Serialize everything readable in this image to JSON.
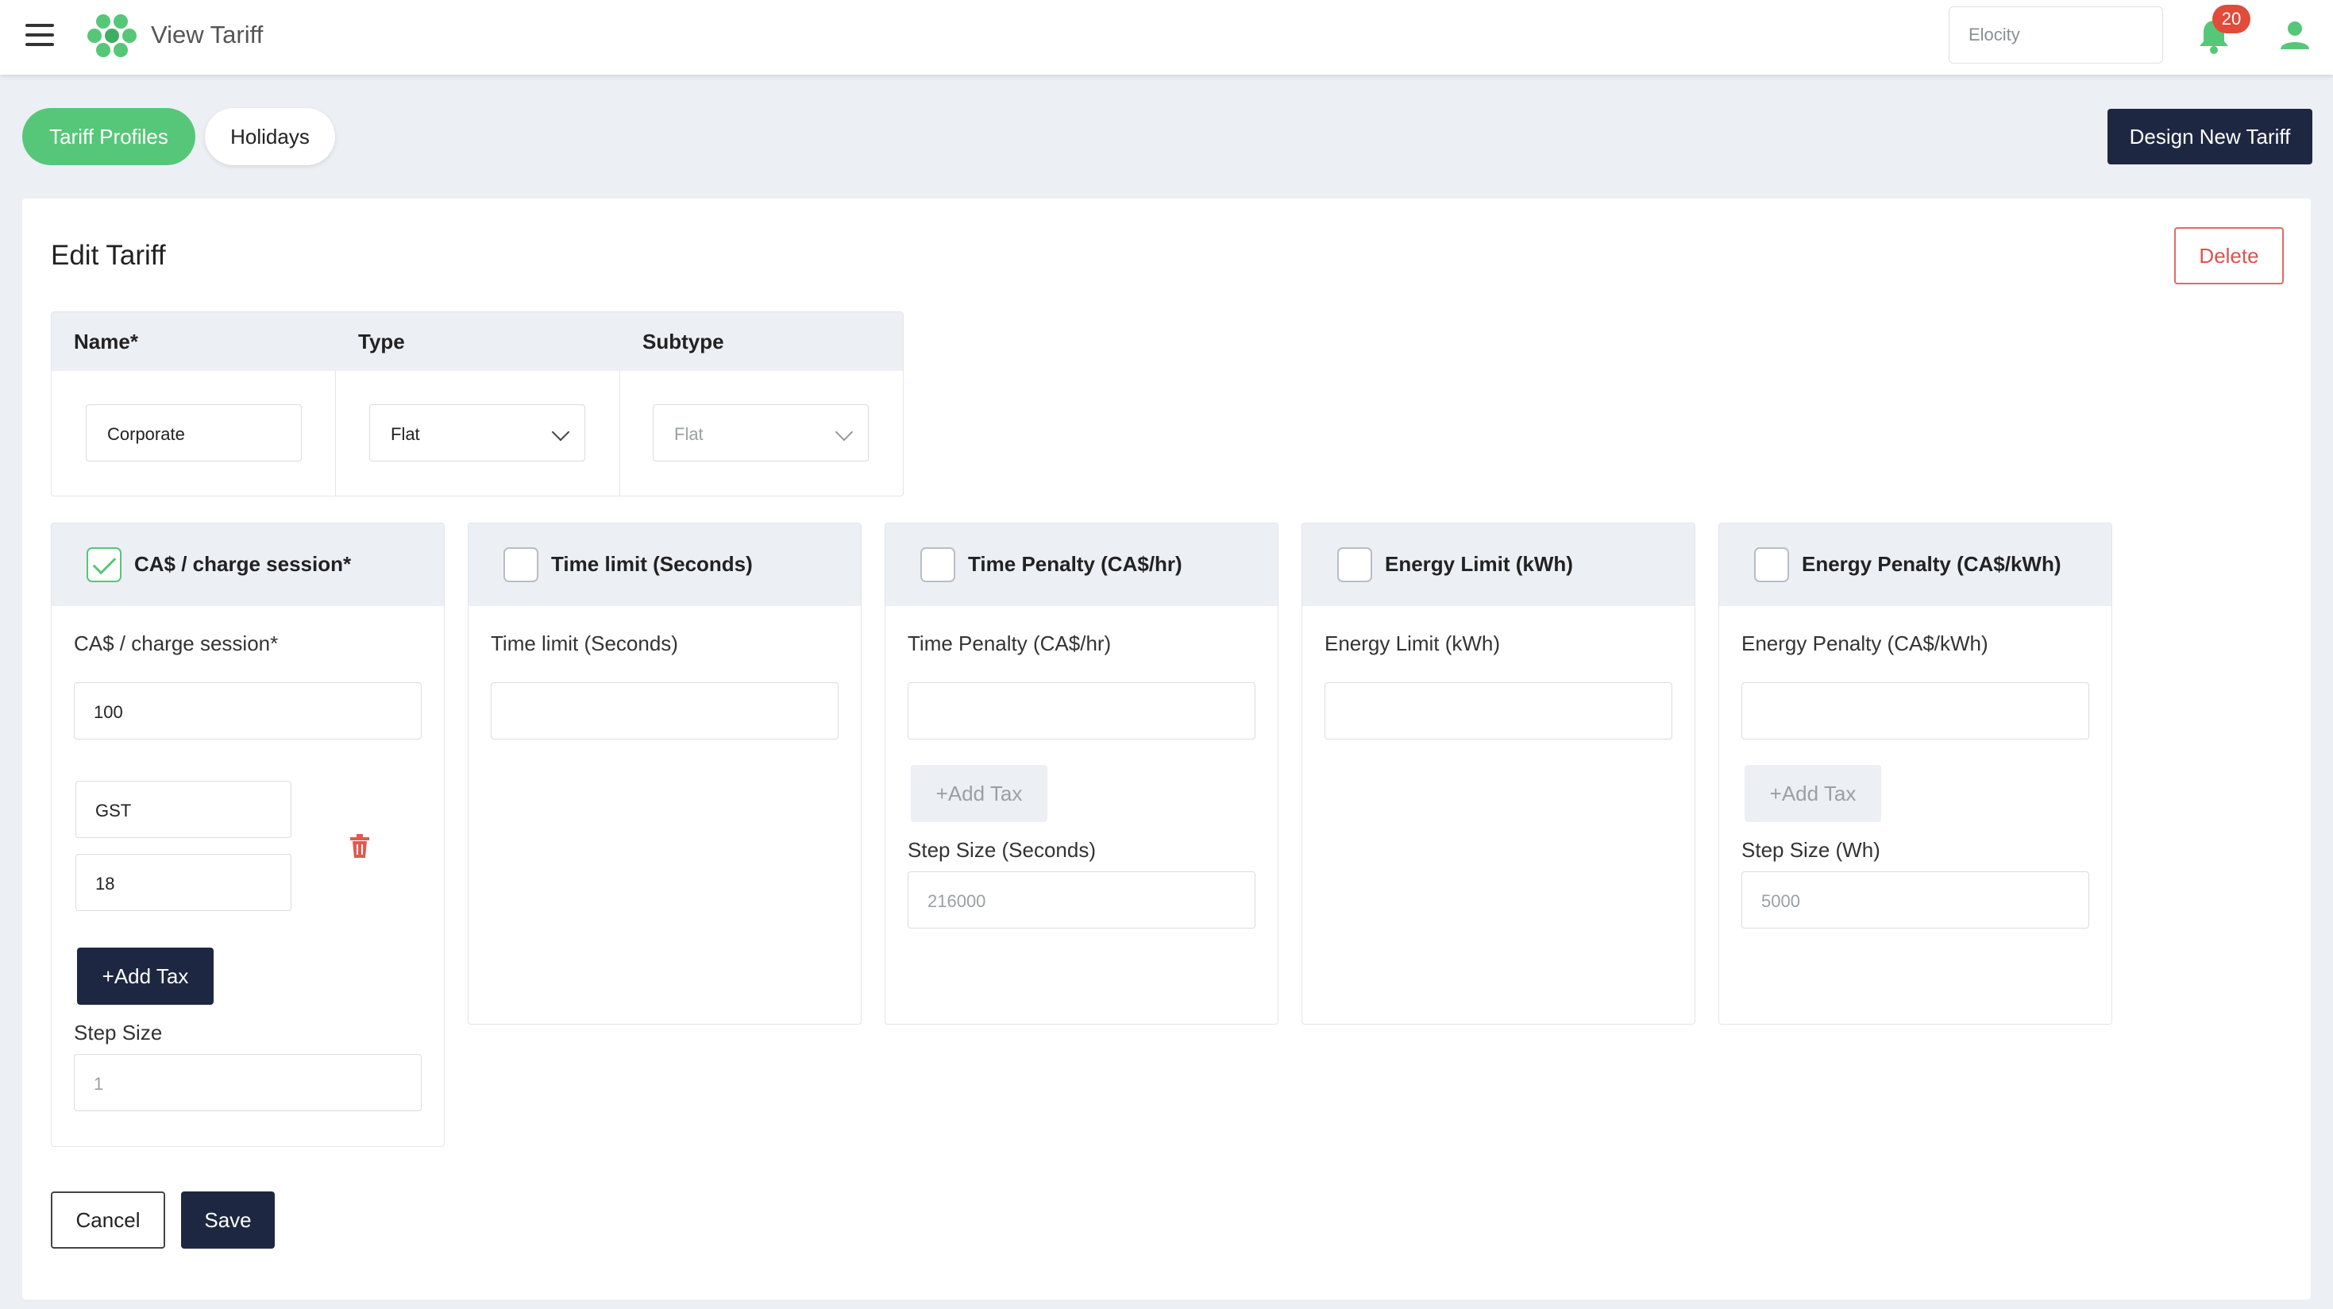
{
  "app": {
    "title": "View Tariff"
  },
  "header": {
    "org_select_value": "Elocity",
    "notification_count": "20"
  },
  "tabs": [
    {
      "label": "Tariff Profiles",
      "active": true
    },
    {
      "label": "Holidays",
      "active": false
    }
  ],
  "actions": {
    "design_new_tariff": "Design New Tariff",
    "delete": "Delete",
    "cancel": "Cancel",
    "save": "Save"
  },
  "editor": {
    "title": "Edit Tariff",
    "columns": {
      "name": "Name*",
      "type": "Type",
      "subtype": "Subtype"
    },
    "values": {
      "name": "Corporate",
      "type": "Flat",
      "subtype": "Flat"
    }
  },
  "params": [
    {
      "title": "CA$ / charge session*",
      "checked": true,
      "field_label": "CA$ / charge session*",
      "value": "100",
      "taxes": [
        {
          "name": "GST",
          "rate": "18"
        }
      ],
      "add_tax_label": "+Add Tax",
      "step_label": "Step Size",
      "step_value": "1"
    },
    {
      "title": "Time limit (Seconds)",
      "checked": false,
      "field_label": "Time limit (Seconds)",
      "value": ""
    },
    {
      "title": "Time Penalty (CA$/hr)",
      "checked": false,
      "field_label": "Time Penalty (CA$/hr)",
      "value": "",
      "add_tax_label": "+Add Tax",
      "step_label": "Step Size (Seconds)",
      "step_value": "216000"
    },
    {
      "title": "Energy Limit (kWh)",
      "checked": false,
      "field_label": "Energy Limit (kWh)",
      "value": ""
    },
    {
      "title": "Energy Penalty (CA$/kWh)",
      "checked": false,
      "field_label": "Energy Penalty (CA$/kWh)",
      "value": "",
      "add_tax_label": "+Add Tax",
      "step_label": "Step Size (Wh)",
      "step_value": "5000"
    }
  ],
  "colors": {
    "accent_green": "#56c778",
    "navy": "#1e2742",
    "danger": "#d9534f",
    "background": "#eceff3"
  },
  "icons": [
    "menu-icon",
    "hexagon-logo-icon",
    "bell-icon",
    "user-icon",
    "check-icon",
    "trash-icon",
    "chevron-down-icon"
  ]
}
